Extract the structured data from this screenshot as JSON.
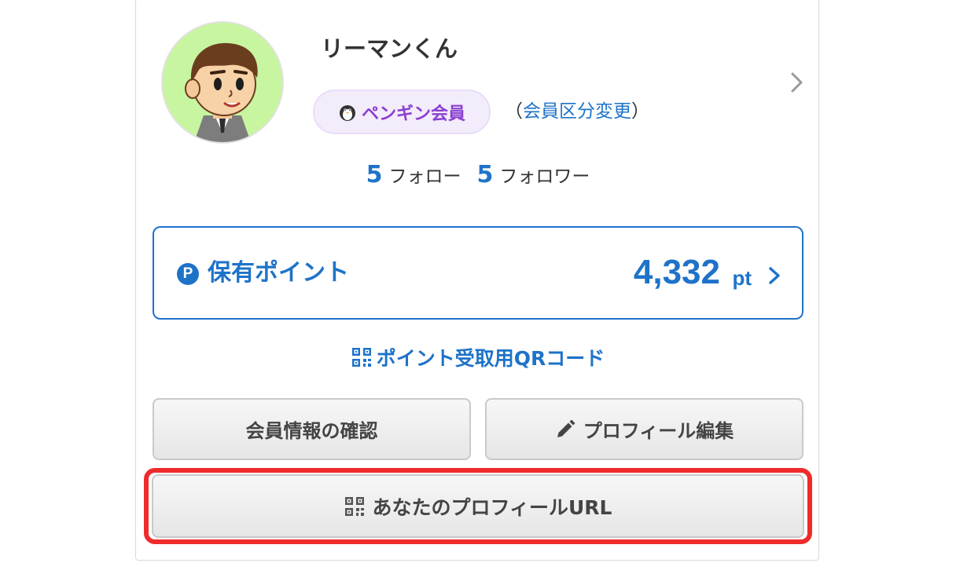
{
  "profile": {
    "username": "リーマンくん",
    "badge_label": "ペンギン会員",
    "change_open": "（",
    "change_link": "会員区分変更",
    "change_close": "）"
  },
  "follow": {
    "following_count": "5",
    "following_label": "フォロー",
    "followers_count": "5",
    "followers_label": "フォロワー"
  },
  "points": {
    "icon_letter": "P",
    "label": "保有ポイント",
    "value": "4,332",
    "unit": "pt"
  },
  "qr_link": "ポイント受取用QRコード",
  "buttons": {
    "member_info": "会員情報の確認",
    "profile_edit": "プロフィール編集",
    "profile_url": "あなたのプロフィールURL"
  },
  "icons": [
    "avatar",
    "chevron-right-icon",
    "penguin-icon",
    "point-icon",
    "qr-code-icon",
    "pencil-icon"
  ],
  "colors": {
    "accent": "#1e73c8",
    "badge_text": "#8a3fd0",
    "badge_bg": "#f3ecfb",
    "highlight": "#ef2b2b",
    "avatar_bg": "#c8f5a0"
  }
}
